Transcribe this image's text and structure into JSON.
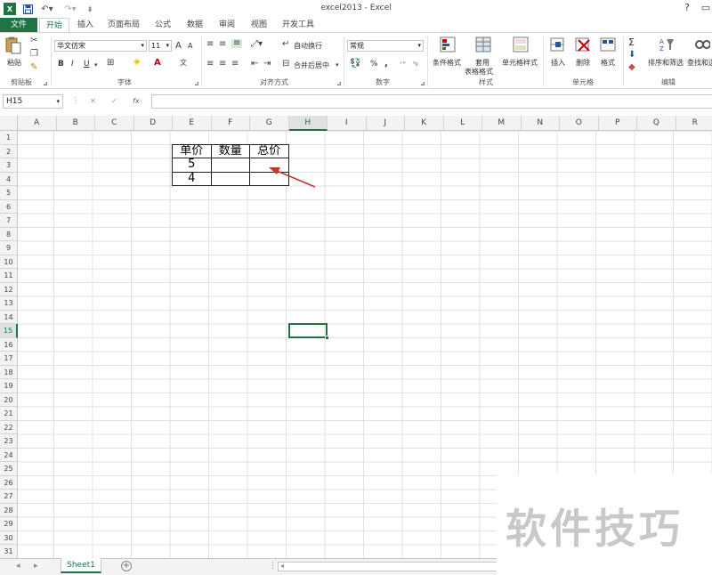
{
  "window": {
    "title": "excel2013 - Excel",
    "help": "?",
    "min": "—",
    "restore": "□"
  },
  "tabs": [
    "文件",
    "开始",
    "插入",
    "页面布局",
    "公式",
    "数据",
    "审阅",
    "视图",
    "开发工具"
  ],
  "ribbon": {
    "clipboard": {
      "paste": "粘贴",
      "label": "剪贴板"
    },
    "font": {
      "name": "华文仿宋",
      "size": "11",
      "label": "字体",
      "grow": "A",
      "shrink": "A",
      "bold": "B",
      "italic": "I",
      "underline": "U"
    },
    "alignment": {
      "wrap": "自动换行",
      "merge": "合并后居中",
      "label": "对齐方式"
    },
    "number": {
      "format": "常规",
      "percent": "%",
      "comma": ",",
      "label": "数字"
    },
    "styles": {
      "conditional": "条件格式",
      "table_1": "套用",
      "table_2": "表格格式",
      "cell": "单元格样式",
      "label": "样式"
    },
    "cells": {
      "insert": "插入",
      "delete": "删除",
      "format": "格式",
      "label": "单元格"
    },
    "editing": {
      "sigma": "Σ",
      "sort": "排序和筛选",
      "find": "查找和选",
      "label": "编辑"
    }
  },
  "formula_bar": {
    "name_box": "H15",
    "cancel": "✕",
    "enter": "✓",
    "fx": "fx",
    "value": ""
  },
  "columns": [
    "A",
    "B",
    "C",
    "D",
    "E",
    "F",
    "G",
    "H",
    "I",
    "J",
    "K",
    "L",
    "M",
    "N",
    "O",
    "P",
    "Q",
    "R"
  ],
  "selected_column": "H",
  "selected_row": 15,
  "row_count": 31,
  "table": {
    "headers": [
      "单价",
      "数量",
      "总价"
    ],
    "rows": [
      [
        "5",
        "",
        ""
      ],
      [
        "4",
        "",
        ""
      ]
    ]
  },
  "sheet_tab": "Sheet1",
  "add_sheet": "+",
  "watermark": "软件技巧",
  "colors": {
    "accent": "#217346",
    "arrow": "#c0392b"
  }
}
